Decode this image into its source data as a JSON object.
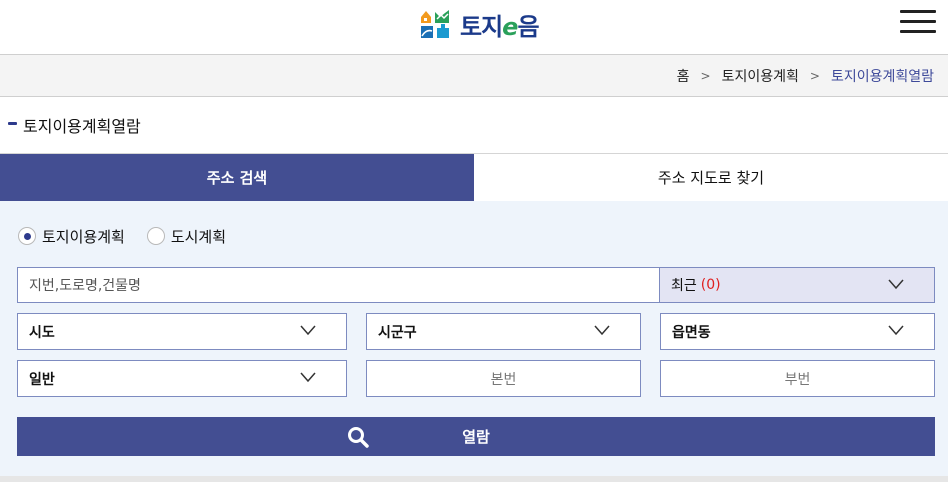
{
  "header": {
    "logo_text_1": "토지",
    "logo_text_2": "e",
    "logo_text_3": "음",
    "menu_icon": "hamburger-icon"
  },
  "breadcrumb": {
    "items": [
      "홈",
      "토지이용계획",
      "토지이용계획열람"
    ],
    "separator_icon": "chevron-right-icon"
  },
  "section": {
    "title": "토지이용계획열람"
  },
  "tabs": [
    {
      "label": "주소 검색",
      "active": true
    },
    {
      "label": "주소 지도로 찾기",
      "active": false
    }
  ],
  "form": {
    "radios": [
      {
        "label": "토지이용계획",
        "checked": true
      },
      {
        "label": "도시계획",
        "checked": false
      }
    ],
    "search_placeholder": "지번,도로명,건물명",
    "recent_label": "최근",
    "recent_count": "(0)",
    "selects": {
      "sido": "시도",
      "sigungu": "시군구",
      "eupmyeondong": "읍면동",
      "land_type": "일반"
    },
    "bonbeon_placeholder": "본번",
    "bubeon_placeholder": "부번",
    "submit_label": "열람"
  },
  "colors": {
    "primary": "#434e92",
    "panel_bg": "#eef4fb",
    "recent_count": "#e02020",
    "breadcrumb_current": "#3e4a9a"
  }
}
